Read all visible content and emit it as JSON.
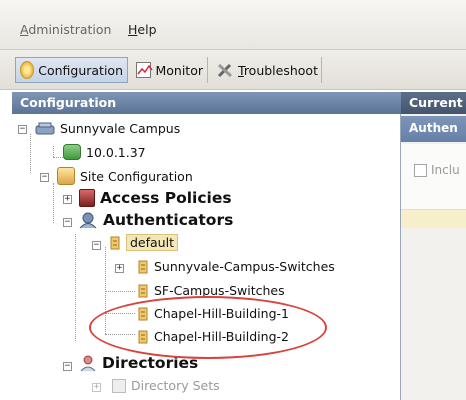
{
  "menu": {
    "administration": "Administration",
    "help": "Help"
  },
  "toolbar": {
    "configuration": "Configuration",
    "monitor": "Monitor",
    "troubleshoot": "Troubleshoot"
  },
  "left_pane": {
    "title": "Configuration"
  },
  "tree": {
    "campus": "Sunnyvale Campus",
    "ip": "10.0.1.37",
    "site_config": "Site Configuration",
    "access_policies": "Access Policies",
    "authenticators": "Authenticators",
    "default": "default",
    "switches_sunnyvale": "Sunnyvale-Campus-Switches",
    "switches_sf": "SF-Campus-Switches",
    "building1": "Chapel-Hill-Building-1",
    "building2": "Chapel-Hill-Building-2",
    "directories": "Directories",
    "directory_sets": "Directory Sets"
  },
  "right_pane": {
    "header": "Current",
    "tab": "Authen",
    "checkbox_label": "Inclu"
  }
}
